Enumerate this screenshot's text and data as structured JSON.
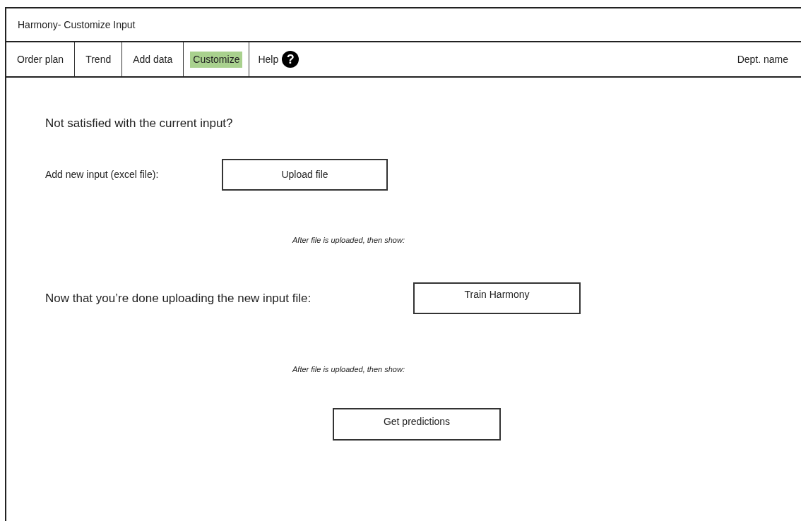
{
  "window": {
    "title": "Harmony- Customize Input"
  },
  "tabs": [
    {
      "label": "Order plan",
      "selected": false
    },
    {
      "label": "Trend",
      "selected": false
    },
    {
      "label": "Add data",
      "selected": false
    },
    {
      "label": "Customize",
      "selected": true
    }
  ],
  "help": {
    "label": "Help",
    "icon_text": "?"
  },
  "dept_label": "Dept. name",
  "heading": "Not satisfied with the current input?",
  "upload": {
    "label": "Add new input (excel file):",
    "button": "Upload file"
  },
  "note_1": "After file is uploaded, then show:",
  "train": {
    "label": "Now that you’re done uploading the new input file:",
    "button": "Train Harmony"
  },
  "note_2": "After file is uploaded, then show:",
  "predict_button": "Get predictions"
}
